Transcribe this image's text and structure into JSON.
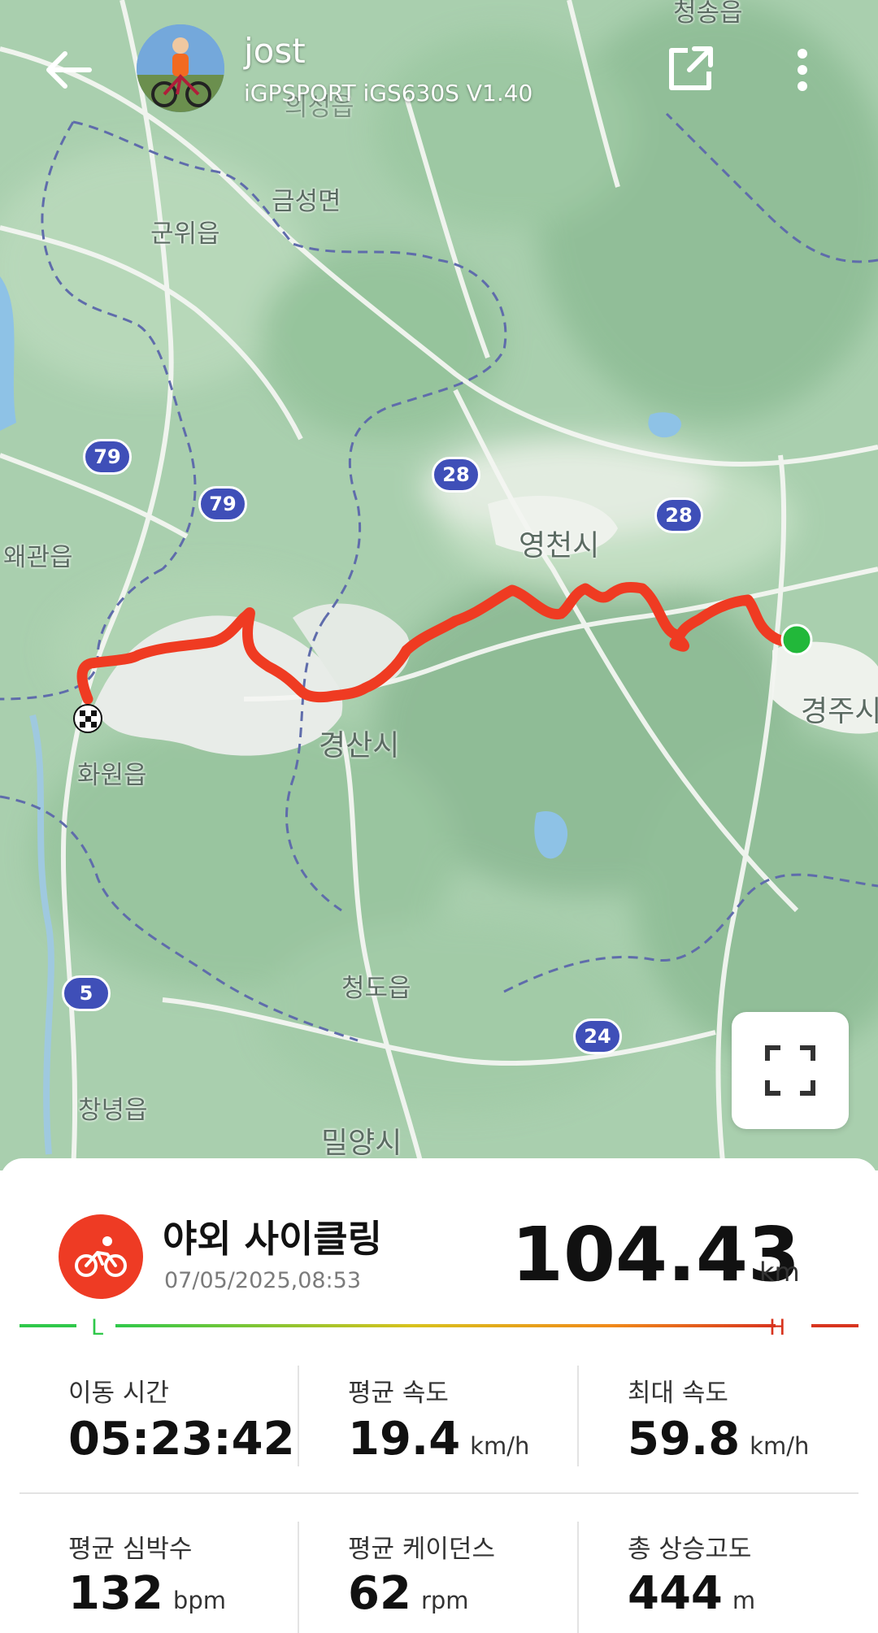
{
  "header": {
    "user_name": "jost",
    "device": "iGPSPORT iGS630S  V1.40"
  },
  "map": {
    "places": [
      {
        "text": "금성면"
      },
      {
        "text": "군위읍"
      },
      {
        "text": "영천시"
      },
      {
        "text": "왜관읍"
      },
      {
        "text": "경산시"
      },
      {
        "text": "경주시"
      },
      {
        "text": "화원읍"
      },
      {
        "text": "청도읍"
      },
      {
        "text": "창녕읍"
      },
      {
        "text": "밀양시"
      },
      {
        "text": "의성읍"
      },
      {
        "text": "청송읍"
      }
    ],
    "road_shields": [
      "79",
      "79",
      "28",
      "28",
      "5",
      "24"
    ]
  },
  "activity": {
    "name": "야외 사이클링",
    "date": "07/05/2025,08:53",
    "distance": "104.43",
    "distance_unit": "km",
    "scale_low": "L",
    "scale_high": "H"
  },
  "stats": [
    {
      "label": "이동 시간",
      "value": "05:23:42",
      "unit": ""
    },
    {
      "label": "평균 속도",
      "value": "19.4",
      "unit": "km/h"
    },
    {
      "label": "최대 속도",
      "value": "59.8",
      "unit": "km/h"
    },
    {
      "label": "평균 심박수",
      "value": "132",
      "unit": "bpm"
    },
    {
      "label": "평균 케이던스",
      "value": "62",
      "unit": "rpm"
    },
    {
      "label": "총 상승고도",
      "value": "444",
      "unit": "m"
    }
  ],
  "colors": {
    "route": "#ef3b22",
    "start": "#22b83a",
    "accent": "#ee3b24",
    "shield": "#3f4fb8"
  }
}
